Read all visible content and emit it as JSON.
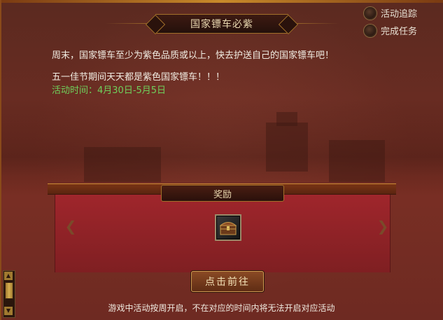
{
  "title": "国家镖车必紫",
  "options": [
    {
      "label": "活动追踪"
    },
    {
      "label": "完成任务"
    }
  ],
  "description": {
    "line1": "周末，国家镖车至少为紫色品质或以上，快去护送自己的国家镖车吧！",
    "line2": "五一佳节期间天天都是紫色国家镖车！！！",
    "time": "活动时间：4月30日-5月5日"
  },
  "reward": {
    "title": "奖励",
    "items": [
      {
        "icon": "treasure-chest-icon"
      }
    ]
  },
  "go_button": "点击前往",
  "notice": "游戏中活动按周开启，不在对应的时间内将无法开启对应活动"
}
